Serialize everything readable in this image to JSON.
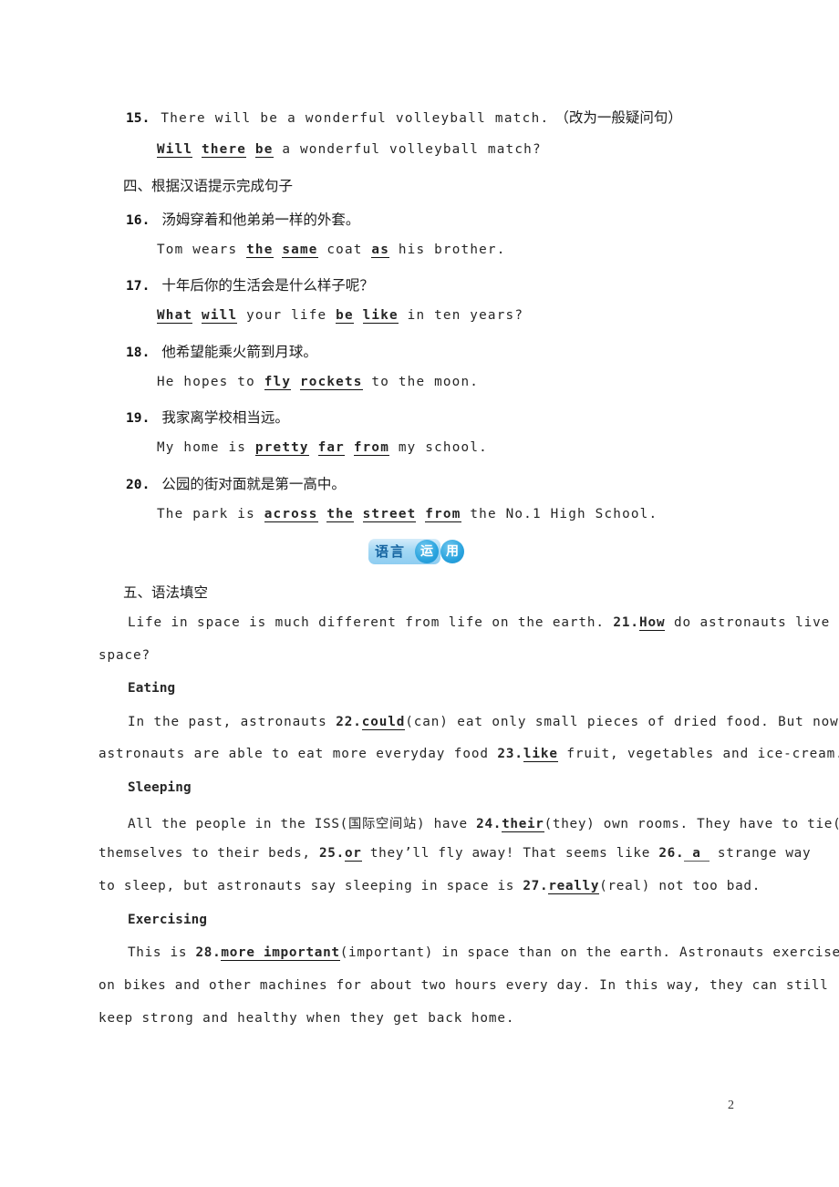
{
  "page": {
    "number": "2",
    "accent_blue": "#29a3de",
    "plate_blue": "#a4d8f4",
    "plate_text_color": "#1463a0"
  },
  "section_three_tail": {
    "items": [
      {
        "num": "15.",
        "prompt_pre": "There will be a wonderful volleyball match.",
        "prompt_paren": "（改为一般疑问句）",
        "answer_parts": [
          {
            "t": "Will",
            "u": true
          },
          {
            "t": " ",
            "u": false
          },
          {
            "t": "there",
            "u": true
          },
          {
            "t": " ",
            "u": false
          },
          {
            "t": "be",
            "u": true
          },
          {
            "t": " a wonderful volleyball match?",
            "u": false
          }
        ]
      }
    ]
  },
  "section_four": {
    "heading": "四、根据汉语提示完成句子",
    "items": [
      {
        "num": "16.",
        "chinese": "汤姆穿着和他弟弟一样的外套。",
        "answer_parts": [
          {
            "t": "Tom wears ",
            "u": false
          },
          {
            "t": "the",
            "u": true
          },
          {
            "t": " ",
            "u": false
          },
          {
            "t": "same",
            "u": true
          },
          {
            "t": " coat ",
            "u": false
          },
          {
            "t": "as",
            "u": true
          },
          {
            "t": " his brother.",
            "u": false
          }
        ]
      },
      {
        "num": "17.",
        "chinese": "十年后你的生活会是什么样子呢？",
        "answer_parts": [
          {
            "t": "What",
            "u": true
          },
          {
            "t": " ",
            "u": false
          },
          {
            "t": "will",
            "u": true
          },
          {
            "t": " your life ",
            "u": false
          },
          {
            "t": "be",
            "u": true
          },
          {
            "t": " ",
            "u": false
          },
          {
            "t": "like",
            "u": true
          },
          {
            "t": " in ten years?",
            "u": false
          }
        ]
      },
      {
        "num": "18.",
        "chinese": "他希望能乘火箭到月球。",
        "answer_parts": [
          {
            "t": "He hopes to ",
            "u": false
          },
          {
            "t": "fly",
            "u": true
          },
          {
            "t": " ",
            "u": false
          },
          {
            "t": "rockets",
            "u": true
          },
          {
            "t": " to the moon.",
            "u": false
          }
        ]
      },
      {
        "num": "19.",
        "chinese": "我家离学校相当远。",
        "answer_parts": [
          {
            "t": "My home is ",
            "u": false
          },
          {
            "t": "pretty",
            "u": true
          },
          {
            "t": " ",
            "u": false
          },
          {
            "t": "far",
            "u": true
          },
          {
            "t": " ",
            "u": false
          },
          {
            "t": "from",
            "u": true
          },
          {
            "t": " my school.",
            "u": false
          }
        ]
      },
      {
        "num": "20.",
        "chinese": "公园的街对面就是第一高中。",
        "answer_parts": [
          {
            "t": "The park is ",
            "u": false
          },
          {
            "t": "across",
            "u": true
          },
          {
            "t": " ",
            "u": false
          },
          {
            "t": "the",
            "u": true
          },
          {
            "t": " ",
            "u": false
          },
          {
            "t": "street",
            "u": true
          },
          {
            "t": " ",
            "u": false
          },
          {
            "t": "from",
            "u": true
          },
          {
            "t": " the No.1 High School.",
            "u": false
          }
        ]
      }
    ]
  },
  "badge": {
    "plate_text": "语言",
    "circle_one": "运",
    "circle_two": "用"
  },
  "section_five": {
    "heading": "五、语法填空",
    "lines": [
      {
        "indent": "indent",
        "parts": [
          {
            "t": "Life in space is much different from life on the earth. ",
            "u": false
          },
          {
            "t": "21.",
            "u": false,
            "num": true
          },
          {
            "t": "How",
            "u": true
          },
          {
            "t": " do astronauts live in",
            "u": false
          }
        ]
      },
      {
        "indent": "flush",
        "parts": [
          {
            "t": "space?",
            "u": false
          }
        ]
      }
    ],
    "subsections": [
      {
        "title": "Eating",
        "lines": [
          {
            "indent": "indent",
            "parts": [
              {
                "t": "In the past, astronauts ",
                "u": false
              },
              {
                "t": "22.",
                "u": false,
                "num": true
              },
              {
                "t": "could",
                "u": true
              },
              {
                "t": "(can) eat only small pieces of dried food. But now",
                "u": false
              }
            ]
          },
          {
            "indent": "flush",
            "parts": [
              {
                "t": "astronauts are able to eat more everyday food ",
                "u": false
              },
              {
                "t": "23.",
                "u": false,
                "num": true
              },
              {
                "t": "like",
                "u": true
              },
              {
                "t": " fruit, vegetables and ice-cream.",
                "u": false
              }
            ]
          }
        ]
      },
      {
        "title": "Sleeping",
        "lines": [
          {
            "indent": "indent",
            "parts": [
              {
                "t": "All the people in the ISS(国际空间站) have ",
                "u": false
              },
              {
                "t": "24.",
                "u": false,
                "num": true
              },
              {
                "t": "their",
                "u": true
              },
              {
                "t": "(they) own rooms. They have to tie(系)",
                "u": false
              }
            ]
          },
          {
            "indent": "flush",
            "parts": [
              {
                "t": "themselves to their beds, ",
                "u": false
              },
              {
                "t": "25.",
                "u": false,
                "num": true
              },
              {
                "t": "or",
                "u": true
              },
              {
                "t": " they’ll fly away! That seems like ",
                "u": false
              },
              {
                "t": "26.",
                "u": false,
                "num": true
              },
              {
                "t": "a",
                "u": false,
                "wide": true
              },
              {
                "t": " strange way",
                "u": false
              }
            ]
          },
          {
            "indent": "flush",
            "parts": [
              {
                "t": "to sleep, but astronauts say sleeping in space is ",
                "u": false
              },
              {
                "t": "27.",
                "u": false,
                "num": true
              },
              {
                "t": "really",
                "u": true
              },
              {
                "t": "(real) not too bad.",
                "u": false
              }
            ]
          }
        ]
      },
      {
        "title": "Exercising",
        "lines": [
          {
            "indent": "indent",
            "parts": [
              {
                "t": "This is ",
                "u": false
              },
              {
                "t": "28.",
                "u": false,
                "num": true
              },
              {
                "t": "more important",
                "u": true
              },
              {
                "t": "(important) in space than on the earth. Astronauts exercise",
                "u": false
              }
            ]
          },
          {
            "indent": "flush",
            "parts": [
              {
                "t": "on bikes and other machines for about two hours every day. In this way, they can still",
                "u": false
              }
            ]
          },
          {
            "indent": "flush",
            "parts": [
              {
                "t": "keep strong and healthy when they get back home.",
                "u": false
              }
            ]
          }
        ]
      }
    ]
  }
}
